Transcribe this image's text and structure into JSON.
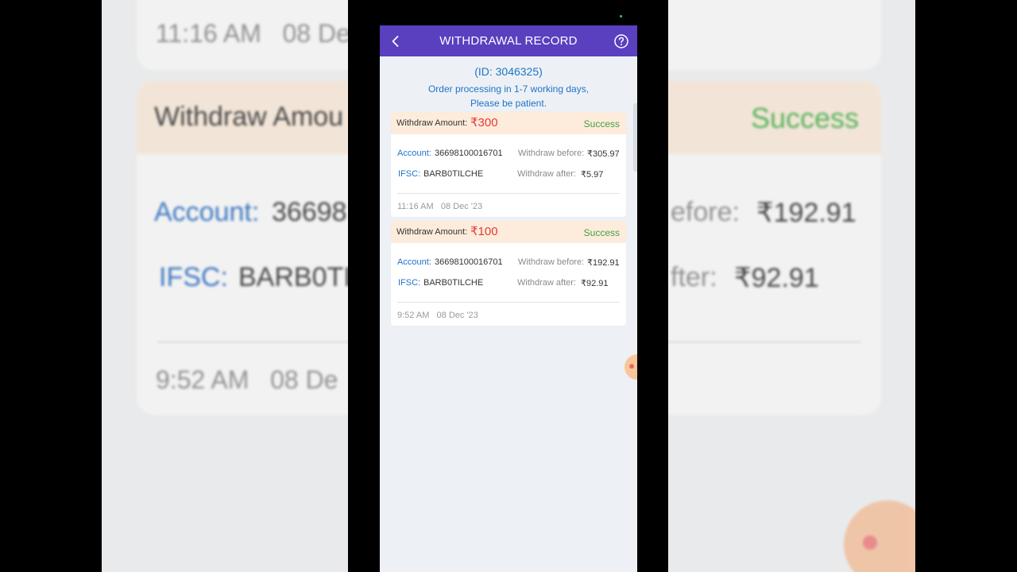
{
  "header": {
    "title": "WITHDRAWAL RECORD"
  },
  "info": {
    "user_id": "(ID: 3046325)",
    "notice_line1": "Order processing in 1-7 working days,",
    "notice_line2": "Please be patient."
  },
  "labels": {
    "withdraw_amount": "Withdraw Amount:",
    "account": "Account:",
    "ifsc": "IFSC:",
    "withdraw_before": "Withdraw before:",
    "withdraw_after": "Withdraw after:"
  },
  "records": [
    {
      "amount": "₹300",
      "status": "Success",
      "account": "36698100016701",
      "ifsc": "BARB0TILCHE",
      "before": "₹305.97",
      "after": "₹5.97",
      "time": "11:16 AM",
      "date": "08 Dec '23"
    },
    {
      "amount": "₹100",
      "status": "Success",
      "account": "36698100016701",
      "ifsc": "BARB0TILCHE",
      "before": "₹192.91",
      "after": "₹92.91",
      "time": "9:52 AM",
      "date": "08 Dec '23"
    }
  ],
  "background": {
    "top_time": "11:16 AM",
    "top_date": "08 Dec",
    "head_label": "Withdraw Amou",
    "head_status": "Success",
    "account_label": "Account:",
    "account_value": "36698",
    "ifsc_label": "IFSC:",
    "ifsc_value": "BARB0TI",
    "before_label": "efore:",
    "before_value": "₹192.91",
    "after_label": "fter:",
    "after_value": "₹92.91",
    "bottom_time": "9:52 AM",
    "bottom_date": "08 De"
  },
  "colors": {
    "header": "#5a3fbf",
    "accent_blue": "#1f73c9",
    "amount_red": "#e53935",
    "success_green": "#43a047"
  },
  "icons": {
    "back": "chevron-left-icon",
    "help": "question-circle-icon"
  }
}
